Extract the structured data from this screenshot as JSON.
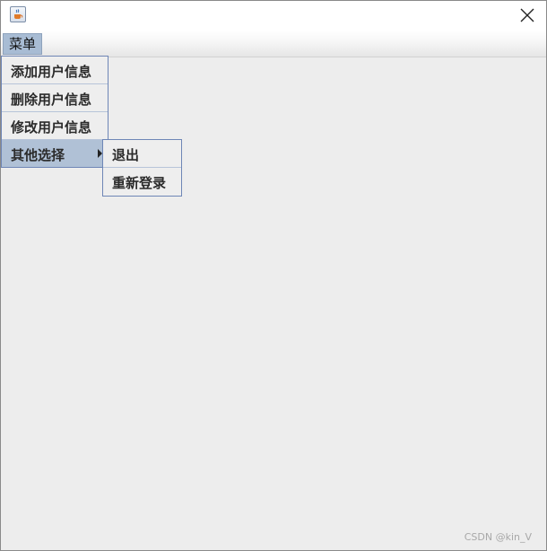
{
  "window": {
    "icon": "java-cup-icon",
    "close_icon": "close-icon"
  },
  "menubar": {
    "menu_label": "菜单"
  },
  "menu": {
    "items": [
      {
        "label": "添加用户信息"
      },
      {
        "label": "删除用户信息"
      },
      {
        "label": "修改用户信息"
      },
      {
        "label": "其他选择",
        "has_submenu": true,
        "selected": true
      }
    ]
  },
  "submenu": {
    "items": [
      {
        "label": "退出"
      },
      {
        "label": "重新登录"
      }
    ]
  },
  "watermark": "CSDN @kin_V",
  "colors": {
    "selection": "#b0c1d6",
    "popup_border": "#6e86b6",
    "content_bg": "#ededed"
  }
}
